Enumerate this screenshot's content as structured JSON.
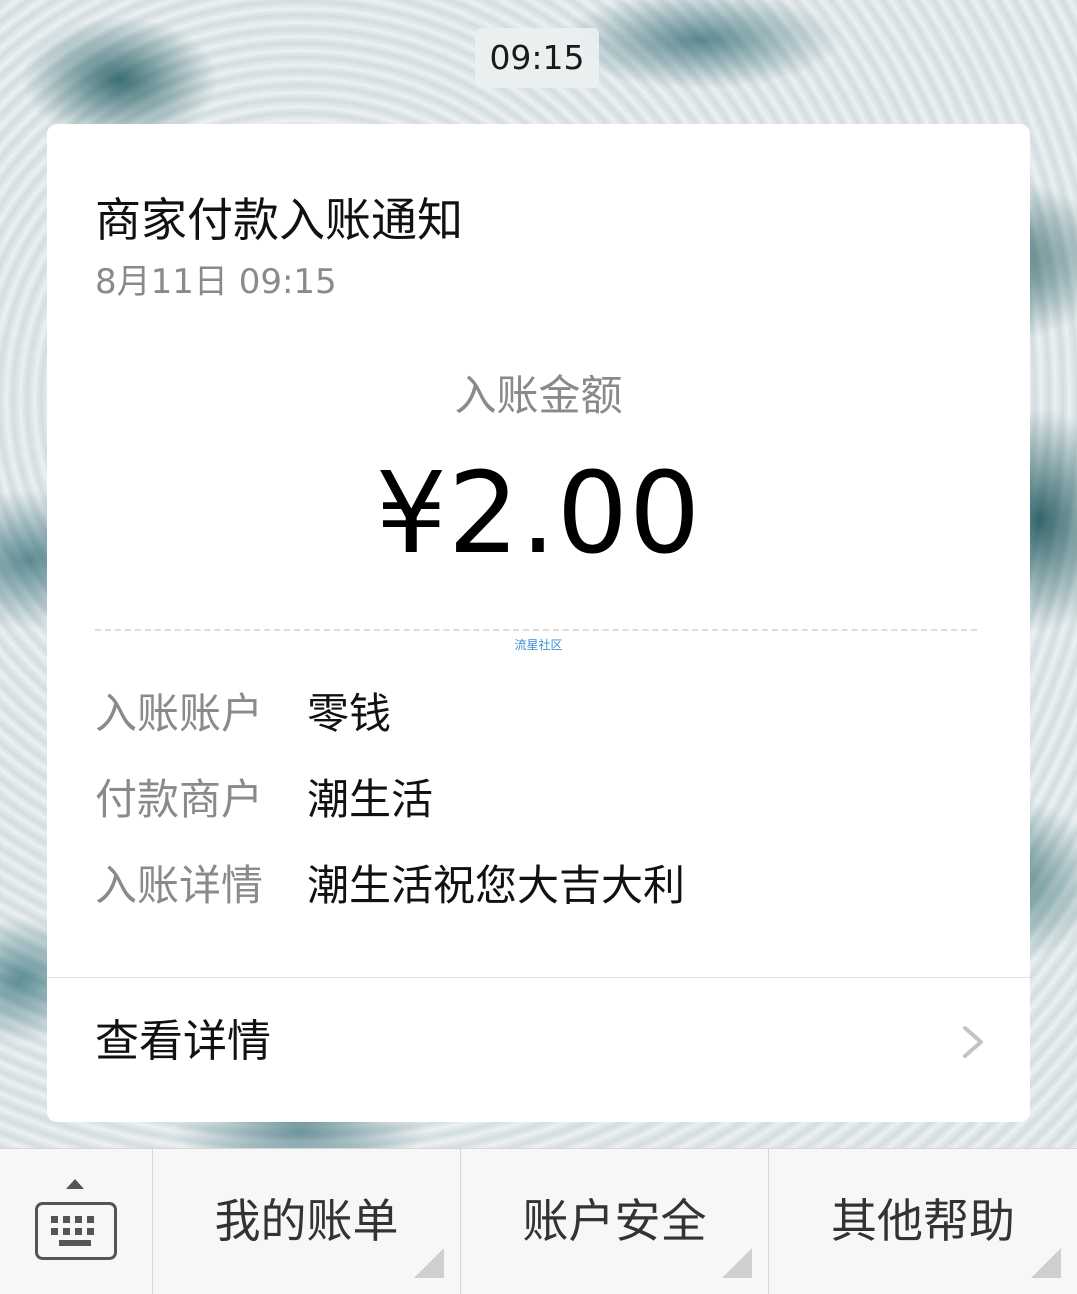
{
  "status": {
    "time": "09:15"
  },
  "notification": {
    "title": "商家付款入账通知",
    "datetime": "8月11日  09:15",
    "amount_label": "入账金额",
    "amount": "¥2.00",
    "watermark": "流星社区",
    "details": [
      {
        "label": "入账账户",
        "value": "零钱"
      },
      {
        "label": "付款商户",
        "value": "潮生活"
      },
      {
        "label": "入账详情",
        "value": "潮生活祝您大吉大利"
      }
    ],
    "view_details_label": "查看详情",
    "view_details_icon": "chevron-right-icon"
  },
  "menu": {
    "keyboard_icon": "keyboard-icon",
    "items": [
      {
        "label": "我的账单"
      },
      {
        "label": "账户安全"
      },
      {
        "label": "其他帮助"
      }
    ]
  },
  "colors": {
    "card_background": "#ffffff",
    "primary_text": "#111111",
    "secondary_text": "#8a8a8a",
    "watermark": "#3b8fd6",
    "menu_bar": "#f7f7f7"
  }
}
